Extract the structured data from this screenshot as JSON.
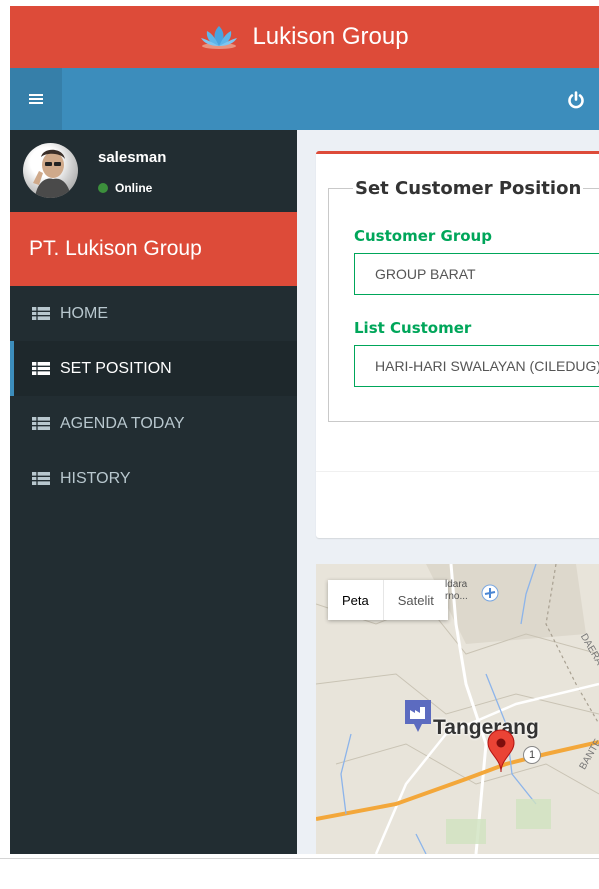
{
  "brand": {
    "title": "Lukison Group"
  },
  "user": {
    "name": "salesman",
    "status": "Online"
  },
  "company": "PT. Lukison Group",
  "menu": [
    {
      "label": "HOME",
      "active": false
    },
    {
      "label": "SET POSITION",
      "active": true
    },
    {
      "label": "AGENDA TODAY",
      "active": false
    },
    {
      "label": "HISTORY",
      "active": false
    }
  ],
  "form": {
    "title": "Set Customer Position",
    "group_label": "Customer Group",
    "group_value": "GROUP BARAT",
    "customer_label": "List Customer",
    "customer_value": "HARI-HARI SWALAYAN (CILEDUG)"
  },
  "map": {
    "type_map": "Peta",
    "type_satellite": "Satelit",
    "city": "Tangerang",
    "airport_label_1": "ldara",
    "airport_label_2": "rno...",
    "area_label_1": "DAERA",
    "area_label_2": "BANTE",
    "road_badge": "1"
  },
  "colors": {
    "red": "#dd4b39",
    "blue": "#3c8dbc",
    "sidebar": "#222d32",
    "green": "#00a65a"
  }
}
